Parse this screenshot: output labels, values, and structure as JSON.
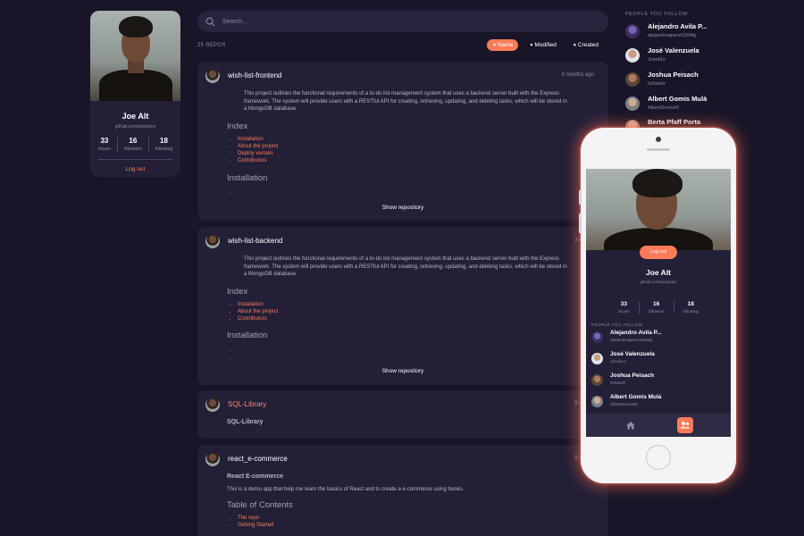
{
  "profile": {
    "name": "Joe Alt",
    "url": "github.com/joejoejoy",
    "stats": [
      {
        "value": "33",
        "label": "issues"
      },
      {
        "value": "16",
        "label": "followers"
      },
      {
        "value": "18",
        "label": "following"
      }
    ],
    "logout_label": "Log out"
  },
  "search": {
    "placeholder": "Search..."
  },
  "repo_count": "25 REPOS",
  "sort": {
    "options": [
      {
        "label": "Name",
        "active": true
      },
      {
        "label": "Modified",
        "active": false
      },
      {
        "label": "Created",
        "active": false
      }
    ]
  },
  "repos": [
    {
      "name": "wish-list-frontend",
      "time": "3 months ago",
      "description": "This project outlines the functional requirements of a to-do list management system that uses a backend server built with the Express framework. The system will provide users with a RESTful API for creating, retrieving, updating, and deleting tasks, which will be stored in a MongoDB database.",
      "heading1": "Index",
      "links": [
        "Installation",
        "About the project",
        "Deploy version",
        "Contributors"
      ],
      "heading2": "Installation",
      "show_label": "Show repository"
    },
    {
      "name": "wish-list-backend",
      "time": "3 month",
      "description": "This project outlines the functional requirements of a to-do list management system that uses a backend server built with the Express framework. The system will provide users with a RESTful API for creating, retrieving, updating, and deleting tasks, which will be stored in a MongoDB database.",
      "heading1": "Index",
      "links": [
        "Installation",
        "About the project",
        "Contributors"
      ],
      "heading2": "Installation",
      "show_label": "Show repository"
    },
    {
      "name": "SQL-Library",
      "time": "5 month",
      "subtitle": "SQL-Library"
    },
    {
      "name": "react_e-commerce",
      "time": "5 month",
      "subtitle": "React E-commerce",
      "text": "This is a demo app that help me learn the basics of React and to create a e-commerce using hooks.",
      "heading1": "Table of Contents",
      "links": [
        "The repo",
        "Getting Started"
      ]
    }
  ],
  "following": {
    "title": "PEOPLE YOU FOLLOW",
    "people": [
      {
        "name": "Alejandro Avila P...",
        "user": "alejandroapenzl1994g"
      },
      {
        "name": "José Valenzuela",
        "user": "Joseli1o"
      },
      {
        "name": "Joshua Peisach",
        "user": "Itz5wirlz"
      },
      {
        "name": "Albert Gomis Mulà",
        "user": "AlbertGomisM"
      },
      {
        "name": "Berta Pfaff Porta",
        "user": ""
      }
    ]
  },
  "phone": {
    "logout_label": "Log out",
    "name": "Joe Alt",
    "url": "github.com/joejoejoy",
    "stats": [
      {
        "value": "33",
        "label": "issues"
      },
      {
        "value": "16",
        "label": "followers"
      },
      {
        "value": "18",
        "label": "following"
      }
    ],
    "follow_title": "PEOPLE YOU FOLLOW",
    "people": [
      {
        "name": "Alejandro Avila P...",
        "user": "alejandroapenzl1994g"
      },
      {
        "name": "José Valenzuela",
        "user": "Joseli1o"
      },
      {
        "name": "Joshua Peisach",
        "user": "Itz5wirlz"
      },
      {
        "name": "Albert Gomis Mulà",
        "user": "AlbertGomisM"
      }
    ]
  },
  "colors": {
    "background": "#181528",
    "card": "#221f37",
    "accent": "#ff7a59",
    "muted": "#8e89a6"
  },
  "icons": [
    "search-icon",
    "home-icon",
    "people-icon",
    "sort-triangle-icon"
  ]
}
